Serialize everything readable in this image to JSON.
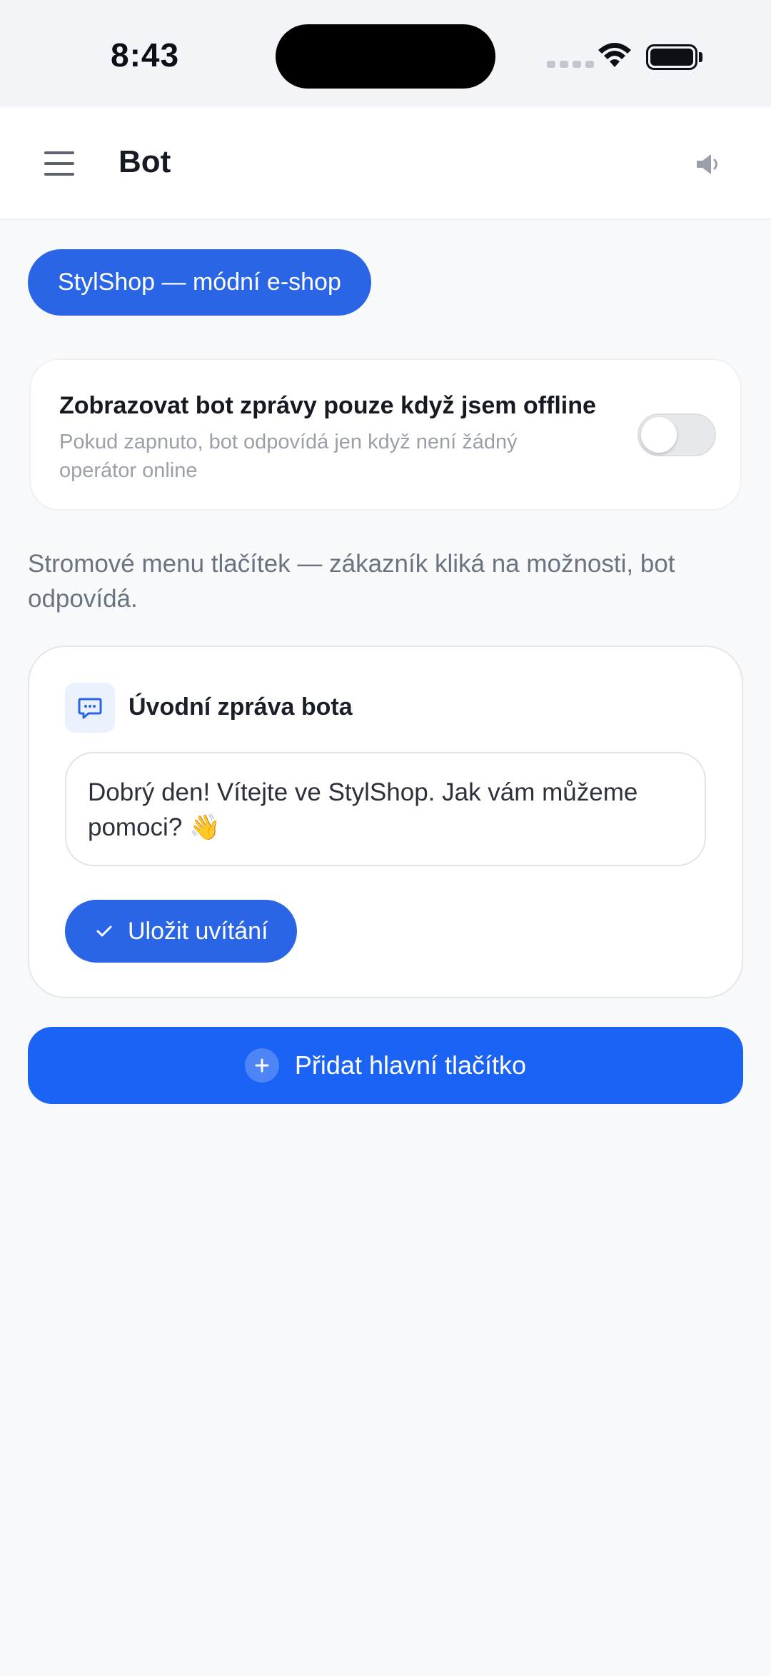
{
  "status_bar": {
    "time": "8:43"
  },
  "header": {
    "title": "Bot",
    "menu_icon": "hamburger-menu-icon",
    "sound_icon": "speaker-icon"
  },
  "shop": {
    "label": "StylShop — módní e-shop"
  },
  "offline_setting": {
    "title": "Zobrazovat bot zprávy pouze když jsem offline",
    "description": "Pokud zapnuto, bot odpovídá jen když není žádný operátor online",
    "enabled": false
  },
  "intro": {
    "text": "Stromové menu tlačítek — zákazník kliká na možnosti, bot odpovídá."
  },
  "welcome": {
    "icon": "chat-bubble-icon",
    "title": "Úvodní zpráva bota",
    "message": "Dobrý den! Vítejte ve StylShop. Jak vám můžeme pomoci? 👋",
    "save_label": "Uložit uvítání"
  },
  "actions": {
    "add_main_button_label": "Přidat hlavní tlačítko"
  },
  "colors": {
    "primary": "#2a65e6",
    "add_button": "#1b63f5",
    "background": "#f8f9fb"
  }
}
